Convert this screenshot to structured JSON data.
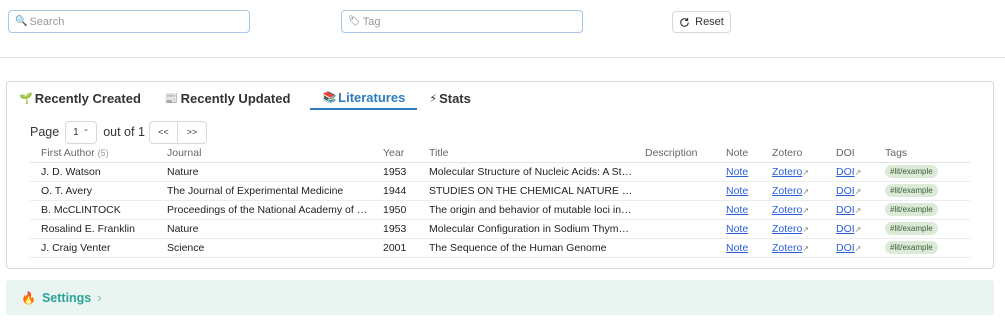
{
  "search": {
    "placeholder": "Search",
    "icon": "search-icon"
  },
  "tag_filter": {
    "placeholder": "Tag",
    "icon": "tag-icon"
  },
  "reset_label": "Reset",
  "tabs": [
    {
      "label": "Recently Created",
      "emoji": "🌱"
    },
    {
      "label": "Recently Updated",
      "emoji": "📰"
    },
    {
      "label": "Literatures",
      "emoji": "📚",
      "active": true
    },
    {
      "label": "Stats",
      "emoji": "⚡"
    }
  ],
  "pager": {
    "prefix": "Page",
    "current": "1",
    "suffix": "out of 1",
    "first": "<<",
    "last": ">>"
  },
  "table": {
    "headers": {
      "author": "First Author",
      "count": "(5)",
      "journal": "Journal",
      "year": "Year",
      "title": "Title",
      "description": "Description",
      "note": "Note",
      "zotero": "Zotero",
      "doi": "DOI",
      "tags": "Tags"
    },
    "rows": [
      {
        "author": "J. D. Watson",
        "journal": "Nature",
        "year": "1953",
        "title": "Molecular Structure of Nucleic Acids: A Structure for Deoxyribose Nucleic Acid",
        "description": "",
        "note": "Note",
        "zotero": "Zotero",
        "doi": "DOI",
        "tag": "#lit/example"
      },
      {
        "author": "O. T. Avery",
        "journal": "The Journal of Experimental Medicine",
        "year": "1944",
        "title": "STUDIES ON THE CHEMICAL NATURE OF THE SUBSTANCE INDUCING TRANSFORMATION",
        "description": "",
        "note": "Note",
        "zotero": "Zotero",
        "doi": "DOI",
        "tag": "#lit/example"
      },
      {
        "author": "B. McCLINTOCK",
        "journal": "Proceedings of the National Academy of Sciences",
        "year": "1950",
        "title": "The origin and behavior of mutable loci in maize",
        "description": "",
        "note": "Note",
        "zotero": "Zotero",
        "doi": "DOI",
        "tag": "#lit/example"
      },
      {
        "author": "Rosalind E. Franklin",
        "journal": "Nature",
        "year": "1953",
        "title": "Molecular Configuration in Sodium Thymonucleate",
        "description": "",
        "note": "Note",
        "zotero": "Zotero",
        "doi": "DOI",
        "tag": "#lit/example"
      },
      {
        "author": "J. Craig Venter",
        "journal": "Science",
        "year": "2001",
        "title": "The Sequence of the Human Genome",
        "description": "",
        "note": "Note",
        "zotero": "Zotero",
        "doi": "DOI",
        "tag": "#lit/example"
      }
    ]
  },
  "settings_label": "Settings",
  "colors": {
    "accent": "#2e7bbf",
    "tag_bg": "#dcebd8",
    "settings_bg": "#eaf5f2",
    "settings_text": "#2aa497"
  }
}
